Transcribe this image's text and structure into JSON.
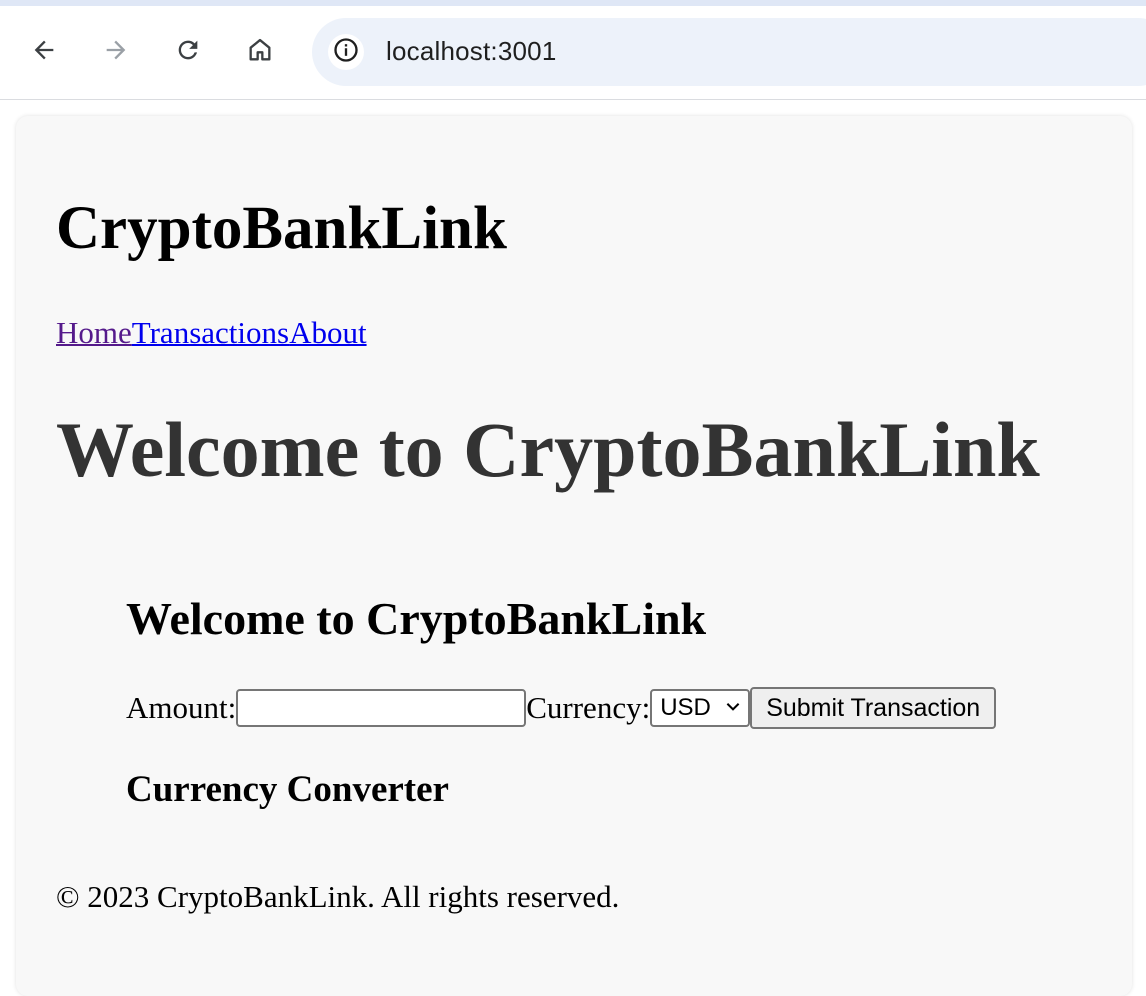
{
  "browser": {
    "url": "localhost:3001",
    "icons": {
      "back": "arrow-left-icon",
      "forward": "arrow-right-icon",
      "reload": "reload-icon",
      "home": "home-icon",
      "site_info": "info-icon"
    }
  },
  "site": {
    "title": "CryptoBankLink",
    "nav": [
      {
        "label": "Home",
        "visited": true
      },
      {
        "label": "Transactions",
        "visited": false
      },
      {
        "label": "About",
        "visited": false
      }
    ],
    "hero_heading": "Welcome to CryptoBankLink",
    "section_heading": "Welcome to CryptoBankLink",
    "form": {
      "amount_label": "Amount:",
      "amount_value": "",
      "currency_label": "Currency:",
      "currency_selected": "USD",
      "submit_label": "Submit Transaction"
    },
    "converter_heading": "Currency Converter",
    "footer": "© 2023 CryptoBankLink. All rights reserved."
  },
  "colors": {
    "visited_link": "#551a8b",
    "link": "#0000ee",
    "hero_text": "#333333",
    "page_background": "#f8f8f8",
    "omnibox_background": "#edf2fa"
  }
}
